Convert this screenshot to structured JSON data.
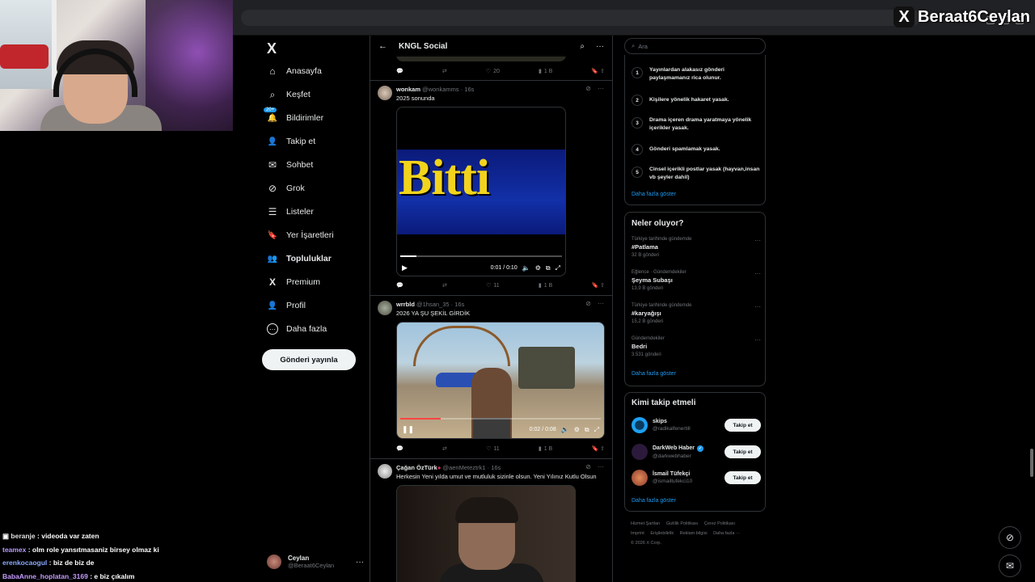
{
  "stream": {
    "display_name": "Beraat6Ceylan",
    "x_badge": "X"
  },
  "nav": {
    "logo": "X",
    "notifications_badge": "20+",
    "items": [
      {
        "label": "Anasayfa",
        "icon": "home-icon",
        "glyph": "⌂"
      },
      {
        "label": "Keşfet",
        "icon": "search-icon",
        "glyph": "⌕"
      },
      {
        "label": "Bildirimler",
        "icon": "bell-icon",
        "glyph": "🔔"
      },
      {
        "label": "Takip et",
        "icon": "person-add-icon",
        "glyph": "👤"
      },
      {
        "label": "Sohbet",
        "icon": "mail-icon",
        "glyph": "✉"
      },
      {
        "label": "Grok",
        "icon": "grok-icon",
        "glyph": "⊘"
      },
      {
        "label": "Listeler",
        "icon": "list-icon",
        "glyph": "☰"
      },
      {
        "label": "Yer İşaretleri",
        "icon": "bookmark-icon",
        "glyph": "🔖"
      },
      {
        "label": "Topluluklar",
        "icon": "communities-icon",
        "glyph": "👥"
      },
      {
        "label": "Premium",
        "icon": "x-icon",
        "glyph": "X"
      },
      {
        "label": "Profil",
        "icon": "profile-icon",
        "glyph": "👤"
      },
      {
        "label": "Daha fazla",
        "icon": "more-circle-icon",
        "glyph": "⋯"
      }
    ],
    "post_button": "Gönderi yayınla",
    "account": {
      "name": "Ceylan",
      "handle": "@Beraat6Ceylan",
      "more": "···"
    }
  },
  "chat": [
    {
      "user": "beranje",
      "msg": ": videoda var zaten"
    },
    {
      "user": "teamex",
      "msg": ": olm role yansıtmasaniz birsey olmaz ki"
    },
    {
      "user": "erenkocaogul",
      "msg": ": biz de biz de"
    },
    {
      "user": "BabaAnne_hoplatan_3169",
      "msg": ": e biz çıkalım"
    }
  ],
  "header": {
    "back": "←",
    "title": "KNGL Social",
    "more": "···"
  },
  "top_actions": {
    "likes": "20",
    "views": "1 B"
  },
  "tweets": [
    {
      "name": "wonkam",
      "handle": "@wonkamms",
      "time": "· 16s",
      "text": "2025 sonunda",
      "media_text": "Bitti",
      "video_time": "0:01 / 0:10",
      "replies": "",
      "retweets": "",
      "likes": "11",
      "views": "1 B"
    },
    {
      "name": "wrrbld",
      "handle": "@1hsan_35",
      "time": "· 16s",
      "text": "2026 YA ŞU ŞEKİL GİRDİK",
      "video_time": "0:02 / 0:08",
      "replies": "",
      "retweets": "",
      "likes": "11",
      "views": "1 B"
    },
    {
      "name": "Çağan ÖzTürk",
      "handle": "@aenMeteztrk1",
      "time": "· 16s",
      "text": "Herkesin Yeni yılda umut ve mutluluk sizinle olsun. Yeni Yılınız Kutlu Olsun"
    }
  ],
  "right": {
    "search_placeholder": "Ara",
    "rules": [
      "Yayınlardan alakasız gönderi paylaşmamanız rica olunur.",
      "Kişilere yönelik hakaret yasak.",
      "Drama içeren drama yaratmaya yönelik içerikler yasak.",
      "Gönderi spamlamak yasak.",
      "Cinsel içerikli postlar yasak (hayvan,insan vb şeyler dahil)"
    ],
    "rules_more": "Daha fazla göster",
    "trends_title": "Neler oluyor?",
    "trends": [
      {
        "context": "Türkiye tarihinde gündemde",
        "topic": "#Patlama",
        "count": "32 B gönderi"
      },
      {
        "context": "Eğlence · Gündemdekiler",
        "topic": "Şeyma Subaşı",
        "count": "13,9 B gönderi"
      },
      {
        "context": "Türkiye tarihinde gündemde",
        "topic": "#karyağışı",
        "count": "15,2 B gönderi"
      },
      {
        "context": "Gündemdekiler",
        "topic": "Bedri",
        "count": "3.531 gönderi"
      }
    ],
    "trends_more": "Daha fazla göster",
    "who_title": "Kimi takip etmeli",
    "who": [
      {
        "name": "skips",
        "handle": "@radikalfenertill",
        "button": "Takip et",
        "color": "#1da1f2"
      },
      {
        "name": "DarkWeb Haber",
        "handle": "@darkwebhaber",
        "button": "Takip et",
        "color": "#2b1a3b"
      },
      {
        "name": "İsmail Tüfekçi",
        "handle": "@ismailtufekci10",
        "button": "Takip et",
        "color": "#c0553a"
      }
    ],
    "who_more": "Daha fazla göster",
    "footer": [
      "Hizmet Şartları",
      "Gizlilik Politikası",
      "Çerez Politikası",
      "Imprint",
      "Erişilebilirlik",
      "Reklam bilgisi",
      "Daha fazla ···",
      "© 2026 X Corp."
    ]
  }
}
